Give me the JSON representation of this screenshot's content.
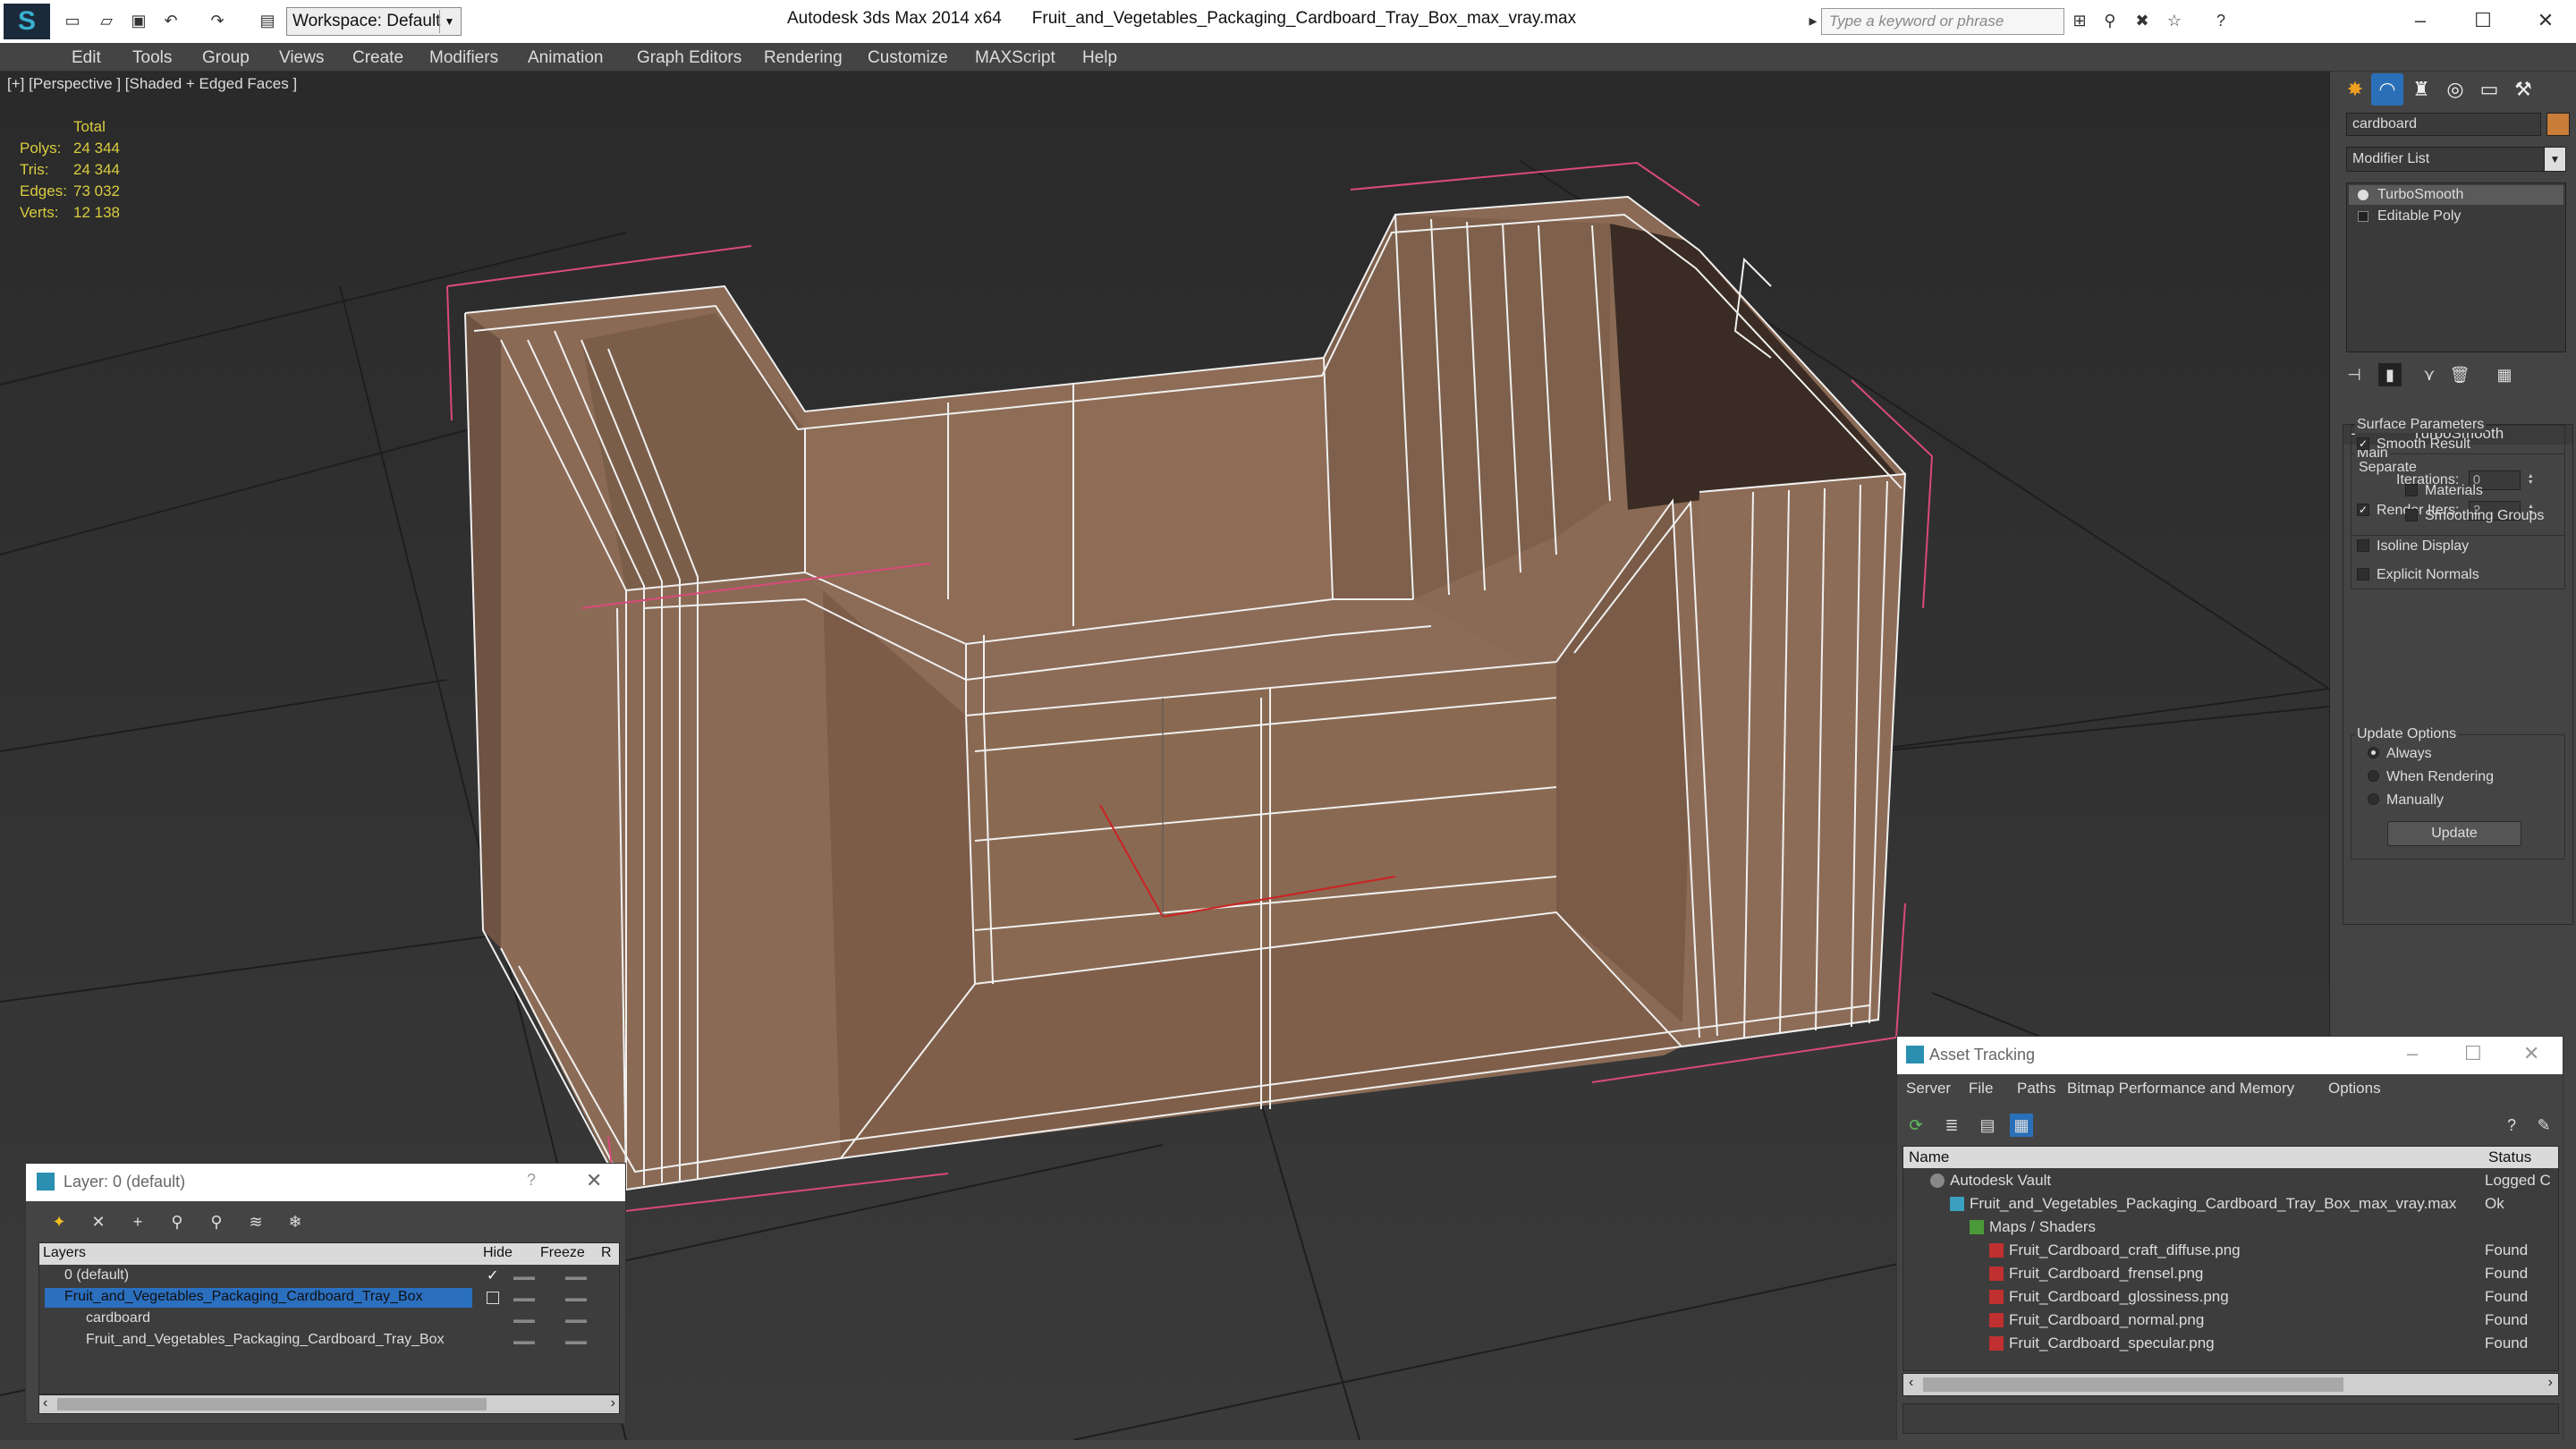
{
  "titlebar": {
    "workspace": "Workspace: Default",
    "app_name": "Autodesk 3ds Max  2014 x64",
    "file_name": "Fruit_and_Vegetables_Packaging_Cardboard_Tray_Box_max_vray.max",
    "search_placeholder": "Type a keyword or phrase"
  },
  "menu": [
    "Edit",
    "Tools",
    "Group",
    "Views",
    "Create",
    "Modifiers",
    "Animation",
    "Graph Editors",
    "Rendering",
    "Customize",
    "MAXScript",
    "Help"
  ],
  "viewport": {
    "label": "[+] [Perspective ] [Shaded + Edged Faces ]",
    "stats_header": "Total",
    "stats": [
      {
        "label": "Polys:",
        "value": "24 344"
      },
      {
        "label": "Tris:",
        "value": "24 344"
      },
      {
        "label": "Edges:",
        "value": "73 032"
      },
      {
        "label": "Verts:",
        "value": "12 138"
      }
    ]
  },
  "command_panel": {
    "object_name": "cardboard",
    "object_color": "#c87d38",
    "modifier_list": "Modifier List",
    "stack": [
      "TurboSmooth",
      "Editable Poly"
    ],
    "rollout_title": "TurboSmooth",
    "main_group": "Main",
    "iterations_label": "Iterations:",
    "iterations_value": "0",
    "render_iters_label": "Render Iters:",
    "render_iters_value": "2",
    "isoline_display": "Isoline Display",
    "explicit_normals": "Explicit Normals",
    "surface_group": "Surface Parameters",
    "smooth_result": "Smooth Result",
    "separate_label": "Separate",
    "materials": "Materials",
    "smoothing_groups": "Smoothing Groups",
    "update_group": "Update Options",
    "update_always": "Always",
    "update_rendering": "When Rendering",
    "update_manually": "Manually",
    "update_button": "Update"
  },
  "layer_dialog": {
    "title": "Layer: 0 (default)",
    "help": "?",
    "col_layers": "Layers",
    "col_hide": "Hide",
    "col_freeze": "Freeze",
    "col_r": "R",
    "rows": [
      {
        "name": "0 (default)"
      },
      {
        "name": "Fruit_and_Vegetables_Packaging_Cardboard_Tray_Box"
      },
      {
        "name": "cardboard"
      },
      {
        "name": "Fruit_and_Vegetables_Packaging_Cardboard_Tray_Box"
      }
    ]
  },
  "asset_tracking": {
    "title": "Asset Tracking",
    "menu": [
      "Server",
      "File",
      "Paths",
      "Bitmap Performance and Memory",
      "Options"
    ],
    "col_name": "Name",
    "col_status": "Status",
    "rows": [
      {
        "name": "Autodesk Vault",
        "status": "Logged C"
      },
      {
        "name": "Fruit_and_Vegetables_Packaging_Cardboard_Tray_Box_max_vray.max",
        "status": "Ok"
      },
      {
        "name": "Maps / Shaders",
        "status": ""
      },
      {
        "name": "Fruit_Cardboard_craft_diffuse.png",
        "status": "Found"
      },
      {
        "name": "Fruit_Cardboard_frensel.png",
        "status": "Found"
      },
      {
        "name": "Fruit_Cardboard_glossiness.png",
        "status": "Found"
      },
      {
        "name": "Fruit_Cardboard_normal.png",
        "status": "Found"
      },
      {
        "name": "Fruit_Cardboard_specular.png",
        "status": "Found"
      }
    ]
  }
}
